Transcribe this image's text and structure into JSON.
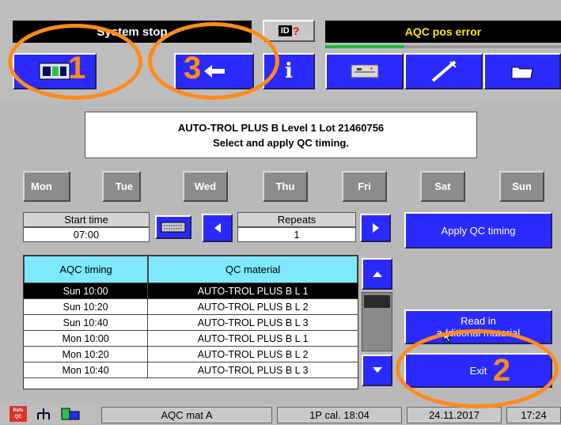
{
  "header": {
    "system_status": "System stop",
    "id_label": "ID",
    "error_text": "AQC pos error"
  },
  "annotations": {
    "one": "1",
    "two": "2",
    "three": "3"
  },
  "icons": {
    "overview": "monitor-icon",
    "back": "arrow-left-icon",
    "info": "info-icon",
    "calibration": "device-icon",
    "syringe": "syringe-icon",
    "folder": "folder-icon",
    "keyboard": "keyboard-icon"
  },
  "info_symbol": "i",
  "message": {
    "line1": "AUTO-TROL PLUS B  Level 1  Lot 21460756",
    "line2": "Select and apply QC timing."
  },
  "days": [
    "Mon",
    "Tue",
    "Wed",
    "Thu",
    "Fri",
    "Sat",
    "Sun"
  ],
  "start_time": {
    "label": "Start time",
    "value": "07:00"
  },
  "repeats": {
    "label": "Repeats",
    "value": "1"
  },
  "apply_button": "Apply QC timing",
  "table": {
    "headers": [
      "AQC timing",
      "QC material"
    ],
    "rows": [
      {
        "timing": "Sun 10:00",
        "material": "AUTO-TROL PLUS B L 1",
        "selected": true
      },
      {
        "timing": "Sun 10:20",
        "material": "AUTO-TROL PLUS B L 2",
        "selected": false
      },
      {
        "timing": "Sun 10:40",
        "material": "AUTO-TROL PLUS B L 3",
        "selected": false
      },
      {
        "timing": "Mon 10:00",
        "material": "AUTO-TROL PLUS B L 1",
        "selected": false
      },
      {
        "timing": "Mon 10:20",
        "material": "AUTO-TROL PLUS B L 2",
        "selected": false
      },
      {
        "timing": "Mon 10:40",
        "material": "AUTO-TROL PLUS B L 3",
        "selected": false
      }
    ]
  },
  "read_button": {
    "line1": "Read in",
    "line2": "additional material"
  },
  "exit_button": "Exit",
  "statusbar": {
    "aqc_mat": "AQC mat A",
    "cal": "1P cal. 18:04",
    "date": "24.11.2017",
    "time": "17:24",
    "flag_label": "Refs QC"
  },
  "colors": {
    "accent": "#2a2aff",
    "highlight": "#ff8a1a",
    "table_header": "#7ee8ff",
    "warning": "#ffea00"
  }
}
